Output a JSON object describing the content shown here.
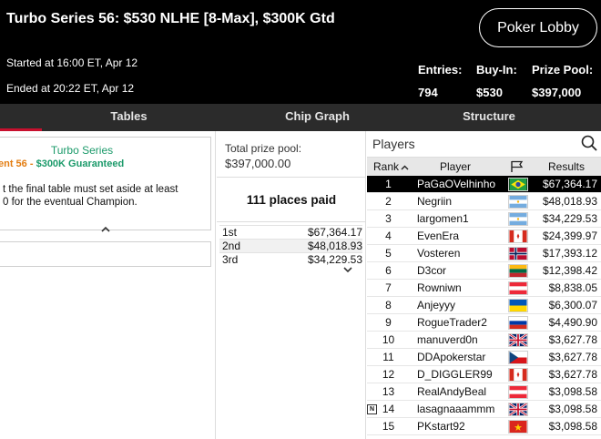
{
  "header": {
    "title": "Turbo Series 56: $530 NLHE [8-Max], $300K Gtd",
    "lobby_button": "Poker Lobby",
    "started": "Started at 16:00 ET, Apr 12",
    "ended": "Ended at 20:22 ET, Apr 12",
    "stats": [
      {
        "label": "Entries:",
        "value": "794"
      },
      {
        "label": "Buy-In:",
        "value": "$530"
      },
      {
        "label": "Prize Pool:",
        "value": "$397,000"
      }
    ]
  },
  "tabs": [
    "Tables",
    "Chip Graph",
    "Structure"
  ],
  "info": {
    "series": "Turbo Series",
    "event": "ent 56 - ",
    "guarantee": "$300K Guaranteed",
    "description": "t the final table must set aside at least\n0 for the eventual Champion."
  },
  "prize": {
    "label": "Total prize pool:",
    "value": "$397,000.00",
    "places_paid": "111 places paid",
    "payouts": [
      {
        "place": "1st",
        "amount": "$67,364.17"
      },
      {
        "place": "2nd",
        "amount": "$48,018.93"
      },
      {
        "place": "3rd",
        "amount": "$34,229.53"
      }
    ]
  },
  "players": {
    "title": "Players",
    "columns": {
      "rank": "Rank",
      "player": "Player",
      "results": "Results"
    },
    "rows": [
      {
        "rank": "1",
        "name": "PaGaOVelhinho",
        "flag": "brazil-flag",
        "result": "$67,364.17"
      },
      {
        "rank": "2",
        "name": "Negriin",
        "flag": "argentina-flag",
        "result": "$48,018.93"
      },
      {
        "rank": "3",
        "name": "largomen1",
        "flag": "argentina-flag",
        "result": "$34,229.53"
      },
      {
        "rank": "4",
        "name": "EvenEra",
        "flag": "canada-flag",
        "result": "$24,399.97"
      },
      {
        "rank": "5",
        "name": "Vosteren",
        "flag": "norway-flag",
        "result": "$17,393.12"
      },
      {
        "rank": "6",
        "name": "D3cor",
        "flag": "lithuania-flag",
        "result": "$12,398.42"
      },
      {
        "rank": "7",
        "name": "Rowniwn",
        "flag": "austria-flag",
        "result": "$8,838.05"
      },
      {
        "rank": "8",
        "name": "Anjeyyy",
        "flag": "ukraine-flag",
        "result": "$6,300.07"
      },
      {
        "rank": "9",
        "name": "RogueTrader2",
        "flag": "russia-flag",
        "result": "$4,490.90"
      },
      {
        "rank": "10",
        "name": "manuverd0n",
        "flag": "uk-flag",
        "result": "$3,627.78"
      },
      {
        "rank": "11",
        "name": "DDApokerstar",
        "flag": "czech-flag",
        "result": "$3,627.78"
      },
      {
        "rank": "12",
        "name": "D_DIGGLER99",
        "flag": "canada-flag",
        "result": "$3,627.78"
      },
      {
        "rank": "13",
        "name": "RealAndyBeal",
        "flag": "austria-flag",
        "result": "$3,098.58"
      },
      {
        "rank": "14",
        "name": "lasagnaaammm",
        "flag": "uk-flag",
        "result": "$3,098.58",
        "badge": "N"
      },
      {
        "rank": "15",
        "name": "PKstart92",
        "flag": "vietnam-flag",
        "result": "$3,098.58"
      }
    ]
  },
  "colors": {
    "accent": "#c8102e",
    "green": "#1b9a6a",
    "orange": "#e37d12"
  }
}
